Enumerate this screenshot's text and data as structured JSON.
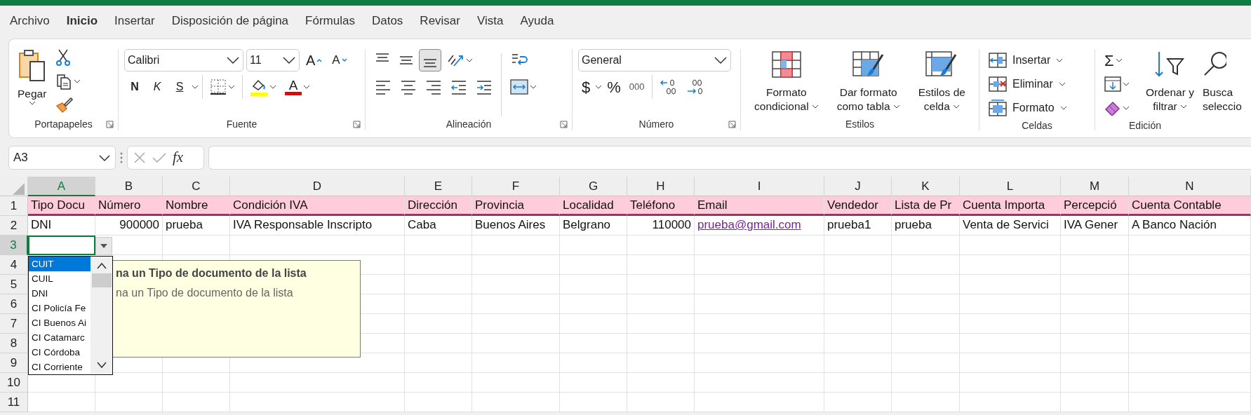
{
  "menu_tabs": [
    {
      "label": "Archivo",
      "selected": false
    },
    {
      "label": "Inicio",
      "selected": true
    },
    {
      "label": "Insertar",
      "selected": false
    },
    {
      "label": "Disposición de página",
      "selected": false
    },
    {
      "label": "Fórmulas",
      "selected": false
    },
    {
      "label": "Datos",
      "selected": false
    },
    {
      "label": "Revisar",
      "selected": false
    },
    {
      "label": "Vista",
      "selected": false
    },
    {
      "label": "Ayuda",
      "selected": false
    }
  ],
  "ribbon": {
    "clipboard": {
      "paste": "Pegar",
      "label": "Portapapeles"
    },
    "font": {
      "name": "Calibri",
      "size": "11",
      "grow": "A",
      "shrink": "A",
      "bold": "N",
      "italic": "K",
      "underline": "S",
      "font_color": "A",
      "label": "Fuente"
    },
    "alignment": {
      "vertical": [
        {
          "selected": false
        },
        {
          "selected": false
        },
        {
          "selected": true
        }
      ],
      "label": "Alineación"
    },
    "number": {
      "format": "General",
      "currency": "$",
      "percent": "%",
      "thousands": "000",
      "label": "Número"
    },
    "styles": {
      "buttons": [
        {
          "line1": "Formato",
          "line2": "condicional"
        },
        {
          "line1": "Dar formato",
          "line2": "como tabla"
        },
        {
          "line1": "Estilos de",
          "line2": "celda"
        }
      ],
      "label": "Estilos"
    },
    "cells": {
      "buttons": [
        "Insertar",
        "Eliminar",
        "Formato"
      ],
      "label": "Celdas"
    },
    "editing": {
      "autosum": "Σ",
      "sort": {
        "line1": "Ordenar y",
        "line2": "filtrar"
      },
      "find": {
        "line1": "Busca",
        "line2": "seleccio"
      },
      "label": "Edición"
    }
  },
  "formula_bar": {
    "name_box": "A3",
    "function_label": "fx"
  },
  "columns": [
    {
      "label": "A",
      "selected": true
    },
    {
      "label": "B",
      "selected": false
    },
    {
      "label": "C",
      "selected": false
    },
    {
      "label": "D",
      "selected": false
    },
    {
      "label": "E",
      "selected": false
    },
    {
      "label": "F",
      "selected": false
    },
    {
      "label": "G",
      "selected": false
    },
    {
      "label": "H",
      "selected": false
    },
    {
      "label": "I",
      "selected": false
    },
    {
      "label": "J",
      "selected": false
    },
    {
      "label": "K",
      "selected": false
    },
    {
      "label": "L",
      "selected": false
    },
    {
      "label": "M",
      "selected": false
    },
    {
      "label": "N",
      "selected": false
    }
  ],
  "rows": [
    {
      "number": "1",
      "selected": false,
      "kind": "header",
      "cells": [
        {
          "text": "Tipo Docu"
        },
        {
          "text": "Número"
        },
        {
          "text": "Nombre"
        },
        {
          "text": "Condición IVA"
        },
        {
          "text": "Dirección"
        },
        {
          "text": "Provincia"
        },
        {
          "text": "Localidad"
        },
        {
          "text": "Teléfono"
        },
        {
          "text": "Email"
        },
        {
          "text": "Vendedor"
        },
        {
          "text": "Lista de Pr"
        },
        {
          "text": "Cuenta Importa"
        },
        {
          "text": "Percepció"
        },
        {
          "text": "Cuenta Contable"
        }
      ]
    },
    {
      "number": "2",
      "selected": false,
      "kind": "data",
      "cells": [
        {
          "text": "DNI"
        },
        {
          "text": "900000",
          "kind": "number"
        },
        {
          "text": "prueba"
        },
        {
          "text": "IVA Responsable Inscripto"
        },
        {
          "text": "Caba"
        },
        {
          "text": "Buenos Aires"
        },
        {
          "text": "Belgrano"
        },
        {
          "text": "110000",
          "kind": "number"
        },
        {
          "text": "prueba@gmail.com",
          "kind": "link"
        },
        {
          "text": "prueba1"
        },
        {
          "text": "prueba"
        },
        {
          "text": "Venta de Servici"
        },
        {
          "text": "IVA Gener"
        },
        {
          "text": "A Banco Nación"
        }
      ]
    },
    {
      "number": "3",
      "selected": true
    },
    {
      "number": "4",
      "selected": false
    },
    {
      "number": "5",
      "selected": false
    },
    {
      "number": "6",
      "selected": false
    },
    {
      "number": "7",
      "selected": false
    },
    {
      "number": "8",
      "selected": false
    },
    {
      "number": "9",
      "selected": false
    },
    {
      "number": "10",
      "selected": false
    },
    {
      "number": "11",
      "selected": false
    }
  ],
  "dropdown": {
    "items": [
      {
        "label": "CUIT",
        "selected": true
      },
      {
        "label": "CUIL",
        "selected": false
      },
      {
        "label": "DNI",
        "selected": false
      },
      {
        "label": "CI Policía Fe",
        "selected": false
      },
      {
        "label": "CI Buenos Ai",
        "selected": false
      },
      {
        "label": "CI Catamarc",
        "selected": false
      },
      {
        "label": "CI Córdoba",
        "selected": false
      },
      {
        "label": "CI Corriente",
        "selected": false
      }
    ]
  },
  "input_message": {
    "title": "na un Tipo de documento de la lista",
    "text": "na un Tipo de documento de la lista"
  }
}
